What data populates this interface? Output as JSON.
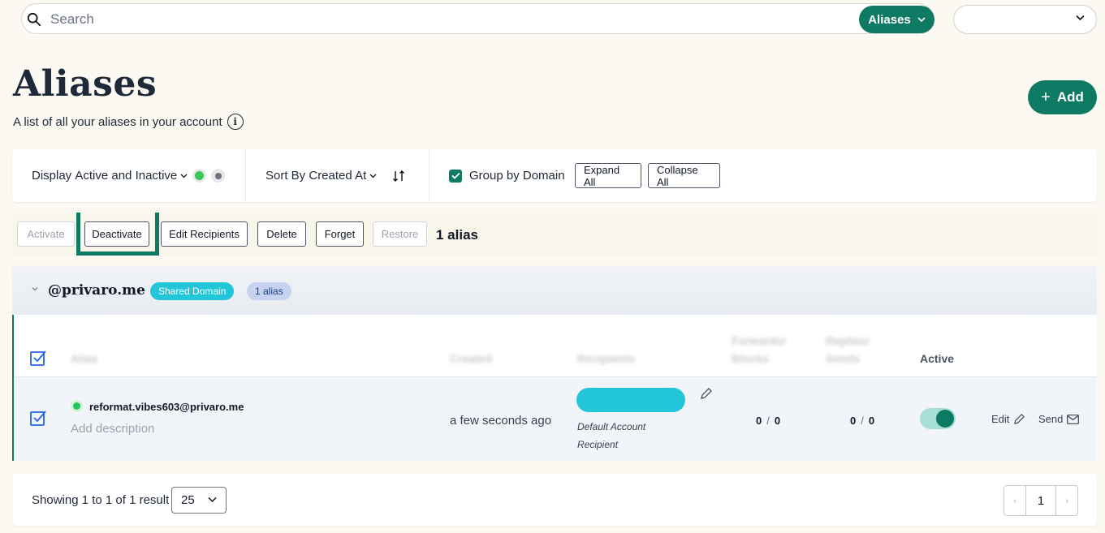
{
  "search": {
    "placeholder": "Search"
  },
  "scope_button": {
    "label": "Aliases"
  },
  "user_select": {
    "value": ""
  },
  "page": {
    "title": "Aliases",
    "subtitle": "A list of all your aliases in your account",
    "info_icon_glyph": "i",
    "add_label": "Add"
  },
  "filters": {
    "display_label": "Display",
    "display_value": "Active and Inactive",
    "status_colors": [
      "#34c759",
      "#6b7280"
    ],
    "sort_label": "Sort By",
    "sort_value": "Created At",
    "group_by_domain_label": "Group by Domain",
    "group_by_domain_checked": true,
    "expand_all": "Expand All",
    "collapse_all": "Collapse All"
  },
  "actions": {
    "activate": "Activate",
    "deactivate": "Deactivate",
    "edit_recipients": "Edit Recipients",
    "delete": "Delete",
    "forget": "Forget",
    "restore": "Restore",
    "count": "1 alias"
  },
  "group": {
    "domain": "@privaro.me",
    "badge_shared": "Shared Domain",
    "badge_count": "1 alias"
  },
  "table": {
    "headers": {
      "alias": "Alias",
      "created": "Created",
      "recipients": "Recipients",
      "forwards_line1": "Forwards/",
      "forwards_line2": "Blocks",
      "replies_line1": "Replies/",
      "replies_line2": "Sends",
      "active": "Active"
    },
    "rows": [
      {
        "email": "reformat.vibes603@privaro.me",
        "description_placeholder": "Add description",
        "created": "a few seconds ago",
        "recipient_note": "Default Account Recipient",
        "forwards": "0",
        "blocks": "0",
        "replies": "0",
        "sends": "0",
        "separator": "/",
        "active": true,
        "edit_label": "Edit",
        "send_label": "Send"
      }
    ]
  },
  "footer": {
    "showing": "Showing 1 to 1 of 1 result",
    "per_page": "25",
    "current_page": "1",
    "prev_glyph": "‹",
    "next_glyph": "›"
  },
  "colors": {
    "brand": "#0f7a63",
    "shared_badge": "#22c6d8",
    "count_badge": "#c6d2ef"
  }
}
